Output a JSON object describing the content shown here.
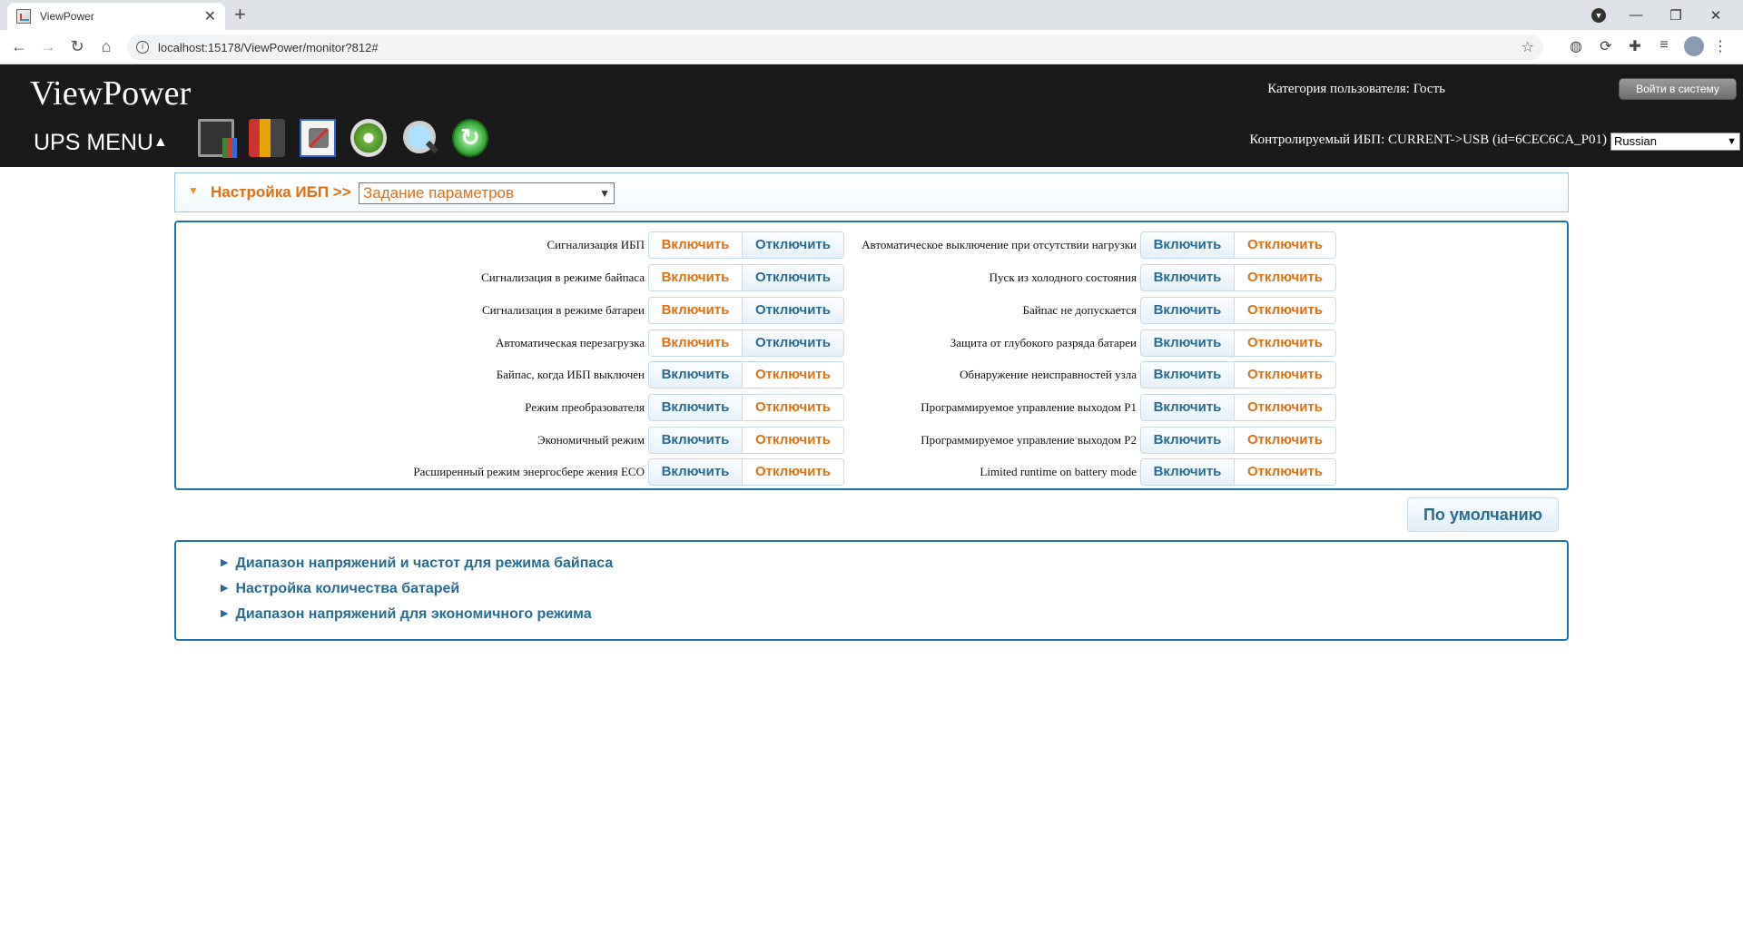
{
  "browser": {
    "tab_title": "ViewPower",
    "close": "✕",
    "new_tab": "+",
    "url": "localhost:15178/ViewPower/monitor?812#",
    "win_min": "—",
    "win_max": "❐",
    "win_close": "✕"
  },
  "header": {
    "logo": "ViewPower",
    "user_category": "Категория пользователя: Гость",
    "login_button": "Войти в систему",
    "ups_menu": "UPS MENU",
    "monitored_ups": "Контролируемый ИБП: CURRENT->USB (id=6CEC6CA_P01)",
    "language": "Russian"
  },
  "settings": {
    "title": "Настройка ИБП >>",
    "select_value": "Задание параметров"
  },
  "buttons": {
    "on": "Включить",
    "off": "Отключить"
  },
  "options_left": [
    {
      "label": "Сигнализация ИБП",
      "state": "on"
    },
    {
      "label": "Сигнализация в режиме байпаса",
      "state": "on"
    },
    {
      "label": "Сигнализация в режиме батареи",
      "state": "on"
    },
    {
      "label": "Автоматическая перезагрузка",
      "state": "on"
    },
    {
      "label": "Байпас, когда ИБП выключен",
      "state": "off"
    },
    {
      "label": "Режим преобразователя",
      "state": "off"
    },
    {
      "label": "Экономичный режим",
      "state": "off"
    },
    {
      "label": "Расширенный режим энергосбере жения ECO",
      "state": "off"
    }
  ],
  "options_right": [
    {
      "label": "Автоматическое выключение при отсутствии нагрузки",
      "state": "off"
    },
    {
      "label": "Пуск из холодного состояния",
      "state": "off"
    },
    {
      "label": "Байпас не допускается",
      "state": "off"
    },
    {
      "label": "Защита от глубокого разряда батареи",
      "state": "off"
    },
    {
      "label": "Обнаружение неисправностей узла",
      "state": "off"
    },
    {
      "label": "Программируемое управление выходом P1",
      "state": "off"
    },
    {
      "label": "Программируемое управление выходом P2",
      "state": "off"
    },
    {
      "label": "Limited runtime on battery mode",
      "state": "off"
    }
  ],
  "default_button": "По умолчанию",
  "sub_sections": [
    "Диапазон напряжений и частот для режима байпаса",
    "Настройка количества батарей",
    "Диапазон напряжений для экономичного режима"
  ]
}
